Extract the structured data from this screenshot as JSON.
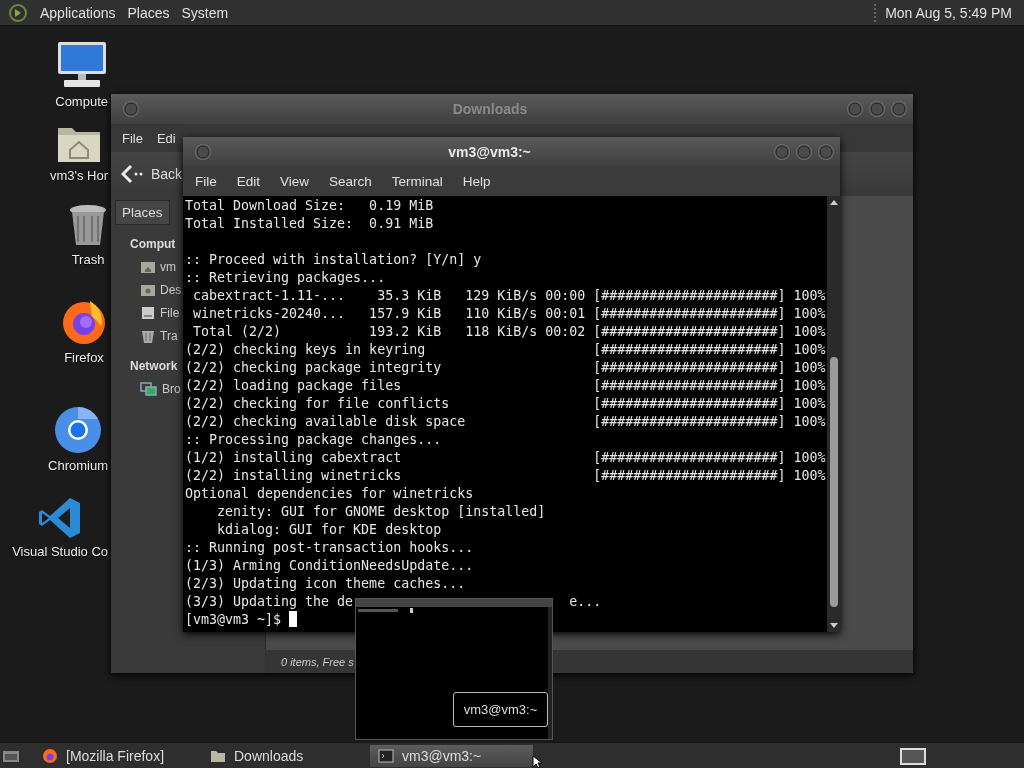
{
  "top_panel": {
    "menus": [
      "Applications",
      "Places",
      "System"
    ],
    "clock": "Mon Aug 5, 5:49 PM"
  },
  "desktop_icons": [
    {
      "label": "Compute",
      "kind": "computer"
    },
    {
      "label": "vm3's Hor",
      "kind": "home"
    },
    {
      "label": "Trash",
      "kind": "trash"
    },
    {
      "label": "Firefox",
      "kind": "firefox"
    },
    {
      "label": "Chromium",
      "kind": "chromium"
    },
    {
      "label": "Visual Studio Co",
      "kind": "vscode"
    }
  ],
  "file_manager": {
    "title": "Downloads",
    "menus": [
      "File",
      "Edi"
    ],
    "back": "Back",
    "sidebar_header": "Places",
    "sections": [
      {
        "title": "Comput",
        "items": [
          {
            "label": "vm",
            "kind": "home"
          },
          {
            "label": "Des",
            "kind": "desktop"
          },
          {
            "label": "File",
            "kind": "drive"
          },
          {
            "label": "Tra",
            "kind": "trash"
          }
        ]
      },
      {
        "title": "Network",
        "items": [
          {
            "label": "Bro",
            "kind": "network"
          }
        ]
      }
    ],
    "status": "0 items, Free s"
  },
  "terminal": {
    "title": "vm3@vm3:~",
    "menus": [
      "File",
      "Edit",
      "View",
      "Search",
      "Terminal",
      "Help"
    ],
    "lines": [
      {
        "kind": "text",
        "text": "Total Download Size:   0.19 MiB"
      },
      {
        "kind": "text",
        "text": "Total Installed Size:  0.91 MiB"
      },
      {
        "kind": "blank"
      },
      {
        "kind": "text",
        "text": ":: Proceed with installation? [Y/n] y"
      },
      {
        "kind": "text",
        "text": ":: Retrieving packages..."
      },
      {
        "kind": "text",
        "text": " cabextract-1.11-...    35.3 KiB   129 KiB/s 00:00 [######################] 100%"
      },
      {
        "kind": "text",
        "text": " winetricks-20240...   157.9 KiB   110 KiB/s 00:01 [######################] 100%"
      },
      {
        "kind": "text",
        "text": " Total (2/2)           193.2 KiB   118 KiB/s 00:02 [######################] 100%"
      },
      {
        "kind": "text",
        "text": "(2/2) checking keys in keyring                     [######################] 100%"
      },
      {
        "kind": "text",
        "text": "(2/2) checking package integrity                   [######################] 100%"
      },
      {
        "kind": "text",
        "text": "(2/2) loading package files                        [######################] 100%"
      },
      {
        "kind": "text",
        "text": "(2/2) checking for file conflicts                  [######################] 100%"
      },
      {
        "kind": "text",
        "text": "(2/2) checking available disk space                [######################] 100%"
      },
      {
        "kind": "text",
        "text": ":: Processing package changes..."
      },
      {
        "kind": "text",
        "text": "(1/2) installing cabextract                        [######################] 100%"
      },
      {
        "kind": "text",
        "text": "(2/2) installing winetricks                        [######################] 100%"
      },
      {
        "kind": "text",
        "text": "Optional dependencies for winetricks"
      },
      {
        "kind": "text",
        "text": "    zenity: GUI for GNOME desktop [installed]"
      },
      {
        "kind": "text",
        "text": "    kdialog: GUI for KDE desktop"
      },
      {
        "kind": "text",
        "text": ":: Running post-transaction hooks..."
      },
      {
        "kind": "text",
        "text": "(1/3) Arming ConditionNeedsUpdate..."
      },
      {
        "kind": "text",
        "text": "(2/3) Updating icon theme caches..."
      },
      {
        "kind": "split",
        "text": "(3/3) Updating the de",
        "tail": "e..."
      }
    ],
    "prompt": "[vm3@vm3 ~]$"
  },
  "window_preview": {
    "label": "vm3@vm3:~"
  },
  "taskbar": {
    "items": [
      {
        "label": "[Mozilla Firefox]",
        "kind": "firefox",
        "selected": false
      },
      {
        "label": "Downloads",
        "kind": "folder",
        "selected": false
      },
      {
        "label": "vm3@vm3:~",
        "kind": "terminal",
        "selected": true
      }
    ]
  }
}
